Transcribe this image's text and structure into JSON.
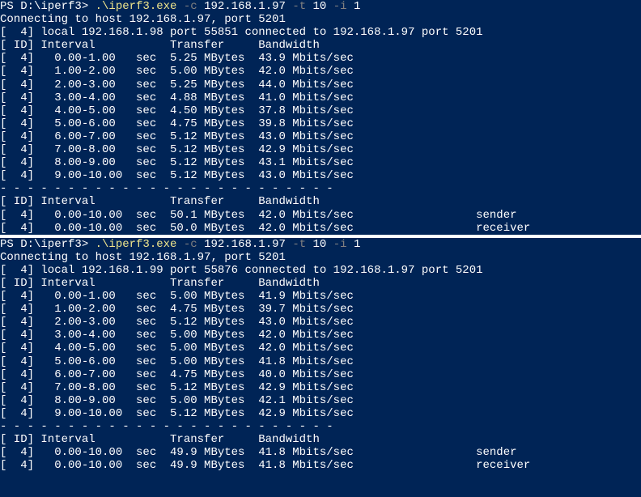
{
  "sessions": [
    {
      "prompt": "PS D:\\iperf3> ",
      "exe": ".\\iperf3.exe",
      "flag_c": "-c",
      "ip": "192.168.1.97",
      "flag_t": "-t",
      "t_val": "10",
      "flag_i": "-i",
      "i_val": "1",
      "connecting": "Connecting to host 192.168.1.97, port 5201",
      "local": "[  4] local 192.168.1.98 port 55851 connected to 192.168.1.97 port 5201",
      "header": "[ ID] Interval           Transfer     Bandwidth",
      "rows": [
        "[  4]   0.00-1.00   sec  5.25 MBytes  43.9 Mbits/sec",
        "[  4]   1.00-2.00   sec  5.00 MBytes  42.0 Mbits/sec",
        "[  4]   2.00-3.00   sec  5.25 MBytes  44.0 Mbits/sec",
        "[  4]   3.00-4.00   sec  4.88 MBytes  41.0 Mbits/sec",
        "[  4]   4.00-5.00   sec  4.50 MBytes  37.8 Mbits/sec",
        "[  4]   5.00-6.00   sec  4.75 MBytes  39.8 Mbits/sec",
        "[  4]   6.00-7.00   sec  5.12 MBytes  43.0 Mbits/sec",
        "[  4]   7.00-8.00   sec  5.12 MBytes  42.9 Mbits/sec",
        "[  4]   8.00-9.00   sec  5.12 MBytes  43.1 Mbits/sec",
        "[  4]   9.00-10.00  sec  5.12 MBytes  43.0 Mbits/sec"
      ],
      "dashes": "- - - - - - - - - - - - - - - - - - - - - - - - -",
      "summary_header": "[ ID] Interval           Transfer     Bandwidth",
      "summary": [
        "[  4]   0.00-10.00  sec  50.1 MBytes  42.0 Mbits/sec                  sender",
        "[  4]   0.00-10.00  sec  50.0 MBytes  42.0 Mbits/sec                  receiver"
      ]
    },
    {
      "prompt": "PS D:\\iperf3> ",
      "exe": ".\\iperf3.exe",
      "flag_c": "-c",
      "ip": "192.168.1.97",
      "flag_t": "-t",
      "t_val": "10",
      "flag_i": "-i",
      "i_val": "1",
      "connecting": "Connecting to host 192.168.1.97, port 5201",
      "local": "[  4] local 192.168.1.99 port 55876 connected to 192.168.1.97 port 5201",
      "header": "[ ID] Interval           Transfer     Bandwidth",
      "rows": [
        "[  4]   0.00-1.00   sec  5.00 MBytes  41.9 Mbits/sec",
        "[  4]   1.00-2.00   sec  4.75 MBytes  39.7 Mbits/sec",
        "[  4]   2.00-3.00   sec  5.12 MBytes  43.0 Mbits/sec",
        "[  4]   3.00-4.00   sec  5.00 MBytes  42.0 Mbits/sec",
        "[  4]   4.00-5.00   sec  5.00 MBytes  42.0 Mbits/sec",
        "[  4]   5.00-6.00   sec  5.00 MBytes  41.8 Mbits/sec",
        "[  4]   6.00-7.00   sec  4.75 MBytes  40.0 Mbits/sec",
        "[  4]   7.00-8.00   sec  5.12 MBytes  42.9 Mbits/sec",
        "[  4]   8.00-9.00   sec  5.00 MBytes  42.1 Mbits/sec",
        "[  4]   9.00-10.00  sec  5.12 MBytes  42.9 Mbits/sec"
      ],
      "dashes": "- - - - - - - - - - - - - - - - - - - - - - - - -",
      "summary_header": "[ ID] Interval           Transfer     Bandwidth",
      "summary": [
        "[  4]   0.00-10.00  sec  49.9 MBytes  41.8 Mbits/sec                  sender",
        "[  4]   0.00-10.00  sec  49.9 MBytes  41.8 Mbits/sec                  receiver"
      ]
    }
  ]
}
